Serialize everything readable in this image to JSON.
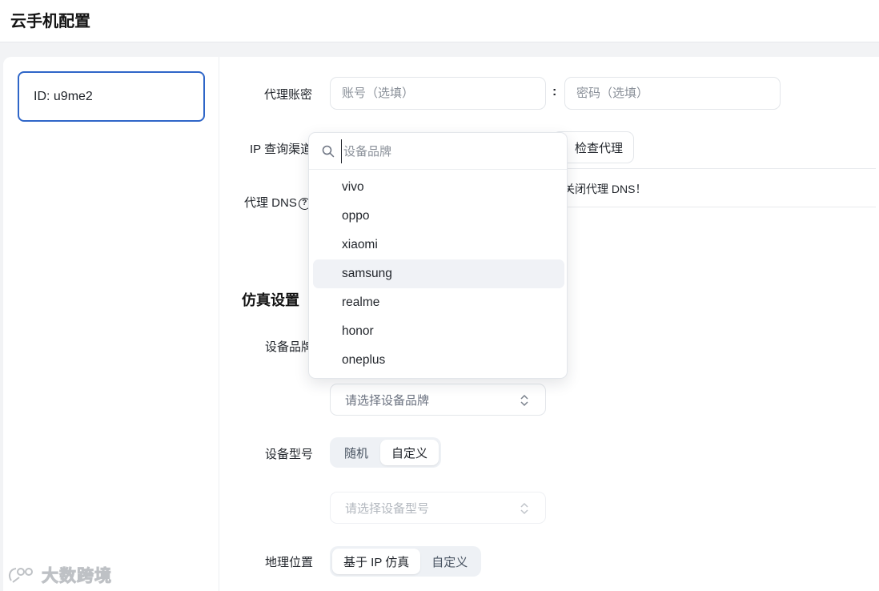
{
  "header": {
    "title": "云手机配置"
  },
  "sidebar": {
    "device_id": "ID: u9me2"
  },
  "proxy": {
    "account_label": "代理账密",
    "account_placeholder": "账号（选填）",
    "separator": ":",
    "password_placeholder": "密码（选填）",
    "ip_channel_label": "IP 查询渠道",
    "check_button": "检查代理",
    "dns_label": "代理 DNS",
    "dns_note": "关闭代理 DNS！"
  },
  "emulation": {
    "section_title": "仿真设置",
    "brand_label": "设备品牌",
    "brand_placeholder": "请选择设备品牌",
    "model_label": "设备型号",
    "model_options": [
      "随机",
      "自定义"
    ],
    "model_selected": "自定义",
    "model_placeholder": "请选择设备型号",
    "location_label": "地理位置",
    "location_options": [
      "基于 IP 仿真",
      "自定义"
    ],
    "location_selected": "基于 IP 仿真"
  },
  "brand_dropdown": {
    "search_placeholder": "设备品牌",
    "items": [
      "vivo",
      "oppo",
      "xiaomi",
      "samsung",
      "realme",
      "honor",
      "oneplus"
    ],
    "highlighted": "samsung"
  },
  "watermark": {
    "text": "大数跨境"
  },
  "colors": {
    "accent": "#2f66c8",
    "border": "#e3e6ea",
    "segment_bg": "#eef1f5",
    "hover_bg": "#f0f2f6"
  }
}
